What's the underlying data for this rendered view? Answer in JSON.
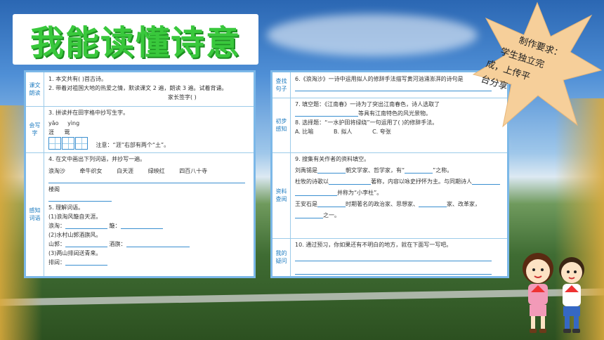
{
  "title": "我能读懂诗意",
  "requirement": {
    "lines": [
      "制作要求：",
      "学生独立完",
      "成，上传平",
      "台分享"
    ]
  },
  "left_panel": {
    "sections": [
      {
        "label": "课文朗读",
        "lines": [
          "1. 本文共有(        )首古诗。",
          "2. 带着对祖国大地的热爱之情，默读课文 2 遍，朗读 3 遍。试着背诵。",
          "家长签字(              )"
        ]
      },
      {
        "label": "会写字",
        "lines": [
          "3. 拼读并在田字格中抄写生字。"
        ],
        "pinyin": [
          "yǎo",
          "yìng"
        ],
        "chars": [
          "涯",
          "莺"
        ],
        "note": "注意：“涯”右部有两个“土”。"
      },
      {
        "label": "感知词语",
        "intro": "4. 在文中画出下列词语，并抄写一遍。",
        "words": [
          "浪淘沙",
          "牵牛织女",
          "白天涯",
          "绿映红",
          "四百八十寺"
        ],
        "words2": [
          "楼阁"
        ],
        "q5": "5. 理解词语。",
        "items": [
          "(1)浪淘风簸自天涯。",
          "浪淘：",
          "簸：",
          "(2)水村山郭酒旗风。",
          "山郭：",
          "酒旗：",
          "(3)两山排闼送青来。",
          "排闼："
        ]
      }
    ]
  },
  "right_panel": {
    "sections": [
      {
        "label": "查找句子",
        "lines": [
          "6.《浪淘沙》一诗中运用拟人的修辞手法描写黄河汹涌澎湃的诗句是"
        ]
      },
      {
        "label": "初步感知",
        "lines": [
          "7. 填空题：《江南春》一诗为了突出江南春色，诗人选取了",
          "等具有江南特色的风光景物。",
          "8. 选择题：“一水护田将绿绕”一句运用了(        )的修辞手法。"
        ],
        "options": [
          "A. 比喻",
          "B. 拟人",
          "C. 夸张"
        ]
      },
      {
        "label": "资料查阅",
        "lines": [
          "9. 搜集有关作者的资料填空。",
          "刘禹锡是",
          "朝文学家、哲学家，有“",
          "”之称。",
          "杜牧的诗歌以",
          "著称，内容以咏史抒怀为主。与同期诗人",
          "并称为“小李杜”。",
          "王安石是",
          "时期著名的政治家、思想家、",
          "家、改革家，",
          "之一。"
        ]
      },
      {
        "label": "我的疑问",
        "lines": [
          "10. 通过预习，你如果还有不明白的地方，就在下面写一写吧。"
        ]
      }
    ]
  }
}
